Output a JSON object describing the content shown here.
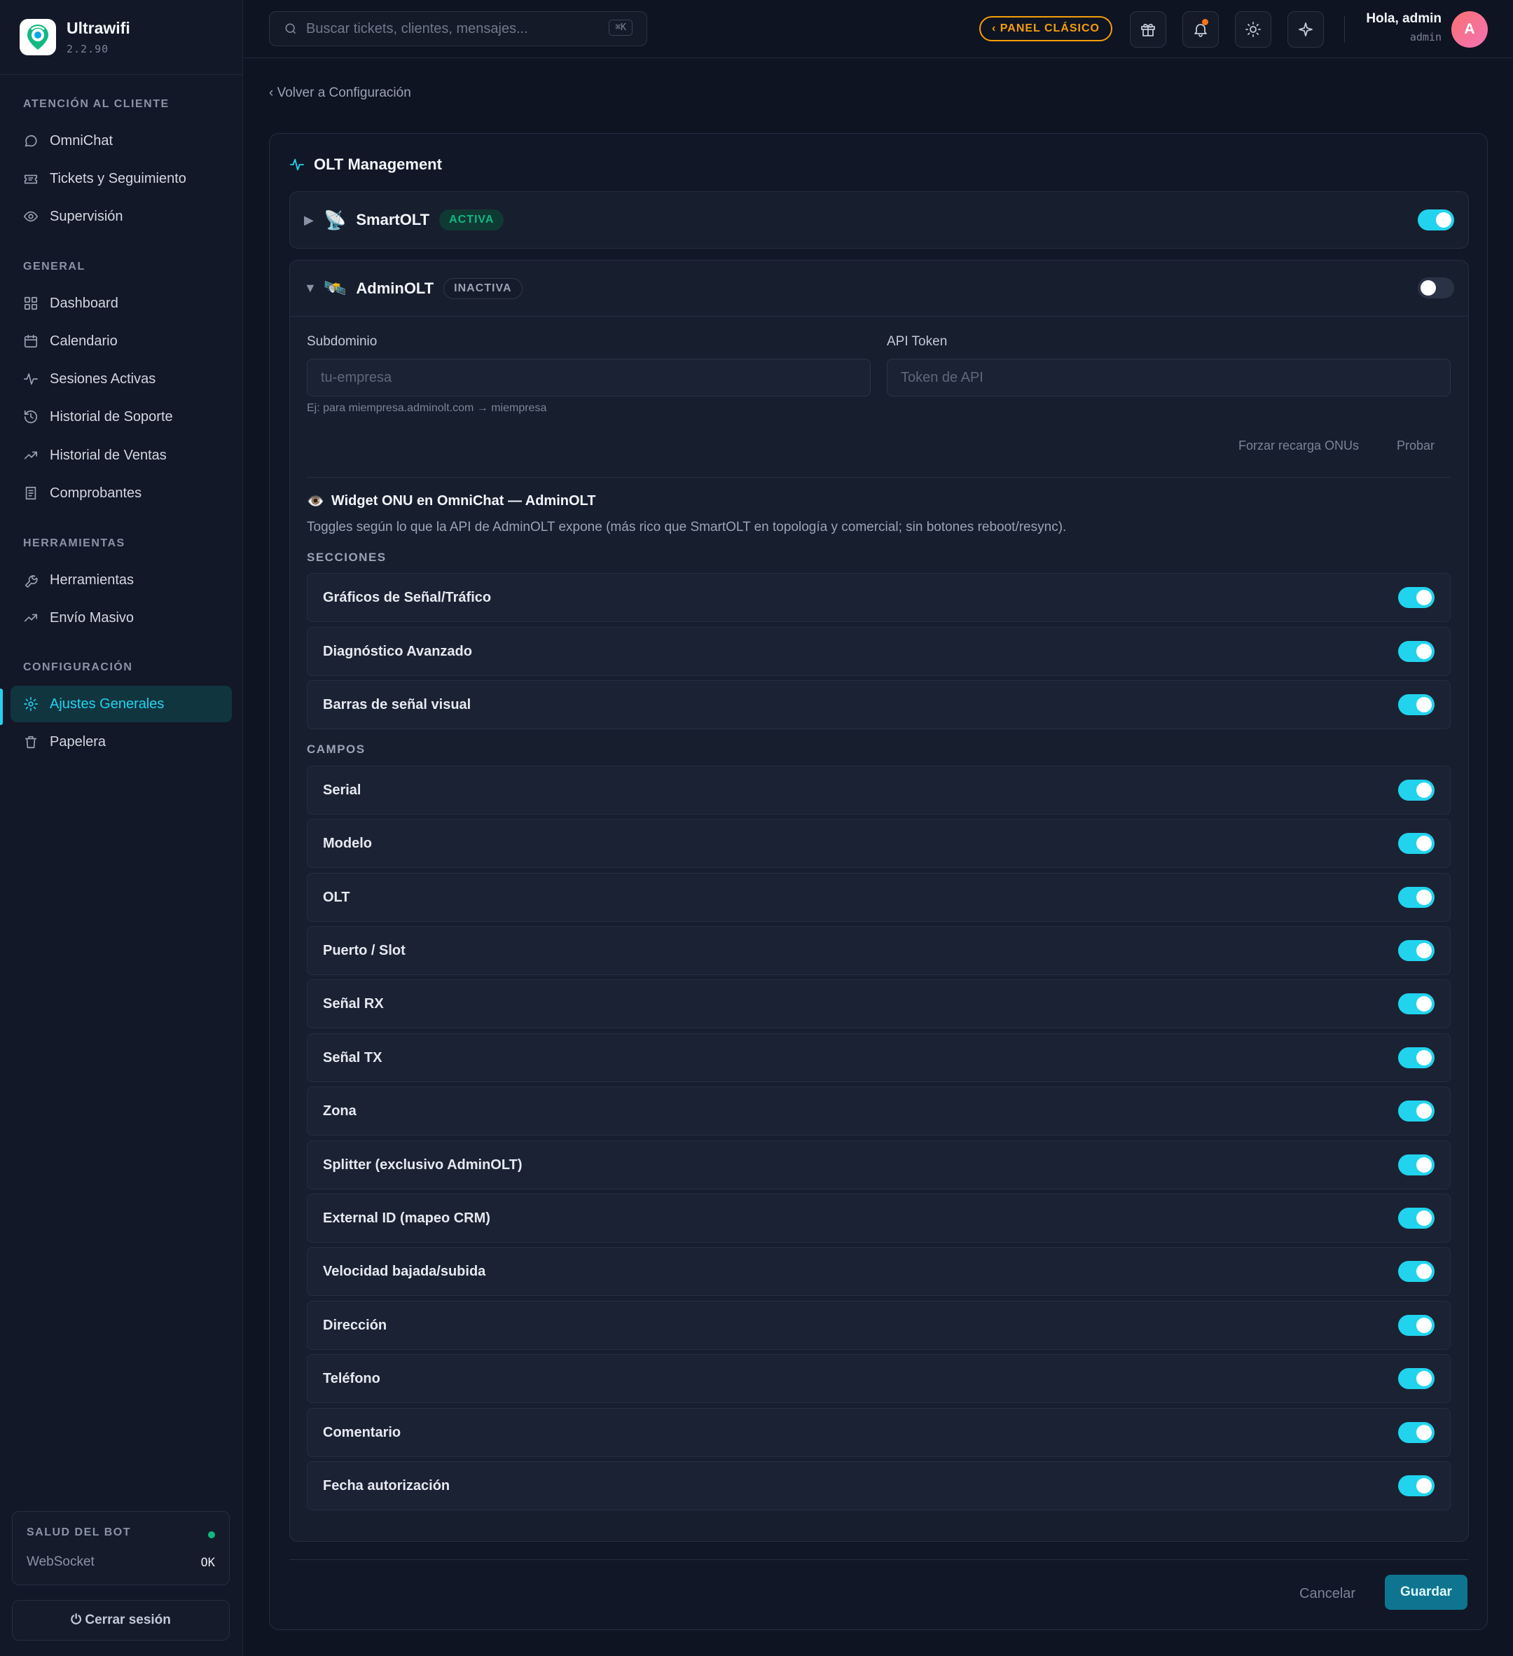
{
  "brand": {
    "name": "Ultrawifi",
    "version": "2.2.90"
  },
  "sidebar": {
    "sections": [
      {
        "title": "ATENCIÓN AL CLIENTE",
        "items": [
          {
            "label": "OmniChat",
            "icon": "chat-icon"
          },
          {
            "label": "Tickets y Seguimiento",
            "icon": "ticket-icon"
          },
          {
            "label": "Supervisión",
            "icon": "eye-icon"
          }
        ]
      },
      {
        "title": "GENERAL",
        "items": [
          {
            "label": "Dashboard",
            "icon": "dashboard-icon"
          },
          {
            "label": "Calendario",
            "icon": "calendar-icon"
          },
          {
            "label": "Sesiones Activas",
            "icon": "activity-icon"
          },
          {
            "label": "Historial de Soporte",
            "icon": "history-icon"
          },
          {
            "label": "Historial de Ventas",
            "icon": "trend-icon"
          },
          {
            "label": "Comprobantes",
            "icon": "receipt-icon"
          }
        ]
      },
      {
        "title": "HERRAMIENTAS",
        "items": [
          {
            "label": "Herramientas",
            "icon": "wrench-icon"
          },
          {
            "label": "Envío Masivo",
            "icon": "trend-icon"
          }
        ]
      },
      {
        "title": "CONFIGURACIÓN",
        "items": [
          {
            "label": "Ajustes Generales",
            "icon": "gear-icon",
            "active": true
          },
          {
            "label": "Papelera",
            "icon": "trash-icon"
          }
        ]
      }
    ],
    "health": {
      "title": "SALUD DEL BOT",
      "label": "WebSocket",
      "value": "OK"
    },
    "logout": "⏻ Cerrar sesión"
  },
  "topbar": {
    "search_placeholder": "Buscar tickets, clientes, mensajes...",
    "search_shortcut": "⌘K",
    "classic_label": "‹ PANEL CLÁSICO",
    "greeting": "Hola, admin",
    "role": "admin",
    "avatar": "A"
  },
  "back_link": "‹ Volver a Configuración",
  "card": {
    "title": "OLT Management",
    "smartolt": {
      "emoji": "📡",
      "name": "SmartOLT",
      "status": "ACTIVA",
      "enabled": true,
      "caret": "▶"
    },
    "adminolt": {
      "emoji": "🛰️",
      "name": "AdminOLT",
      "status": "INACTIVA",
      "enabled": false,
      "caret": "▼",
      "subdomain_label": "Subdominio",
      "subdomain_placeholder": "tu-empresa",
      "subdomain_hint": "Ej: para miempresa.adminolt.com → miempresa",
      "token_label": "API Token",
      "token_placeholder": "Token de API",
      "force_reload": "Forzar recarga ONUs",
      "test": "Probar",
      "widget_emoji": "👁️",
      "widget_title": "Widget ONU en OmniChat — AdminOLT",
      "widget_desc": "Toggles según lo que la API de AdminOLT expone (más rico que SmartOLT en topología y comercial; sin botones reboot/resync).",
      "sections_title": "SECCIONES",
      "sections": [
        {
          "label": "Gráficos de Señal/Tráfico",
          "on": true
        },
        {
          "label": "Diagnóstico Avanzado",
          "on": true
        },
        {
          "label": "Barras de señal visual",
          "on": true
        }
      ],
      "fields_title": "CAMPOS",
      "fields": [
        {
          "label": "Serial",
          "on": true
        },
        {
          "label": "Modelo",
          "on": true
        },
        {
          "label": "OLT",
          "on": true
        },
        {
          "label": "Puerto / Slot",
          "on": true
        },
        {
          "label": "Señal RX",
          "on": true
        },
        {
          "label": "Señal TX",
          "on": true
        },
        {
          "label": "Zona",
          "on": true
        },
        {
          "label": "Splitter (exclusivo AdminOLT)",
          "on": true
        },
        {
          "label": "External ID (mapeo CRM)",
          "on": true
        },
        {
          "label": "Velocidad bajada/subida",
          "on": true
        },
        {
          "label": "Dirección",
          "on": true
        },
        {
          "label": "Teléfono",
          "on": true
        },
        {
          "label": "Comentario",
          "on": true
        },
        {
          "label": "Fecha autorización",
          "on": true
        }
      ]
    },
    "cancel": "Cancelar",
    "save": "Guardar"
  }
}
